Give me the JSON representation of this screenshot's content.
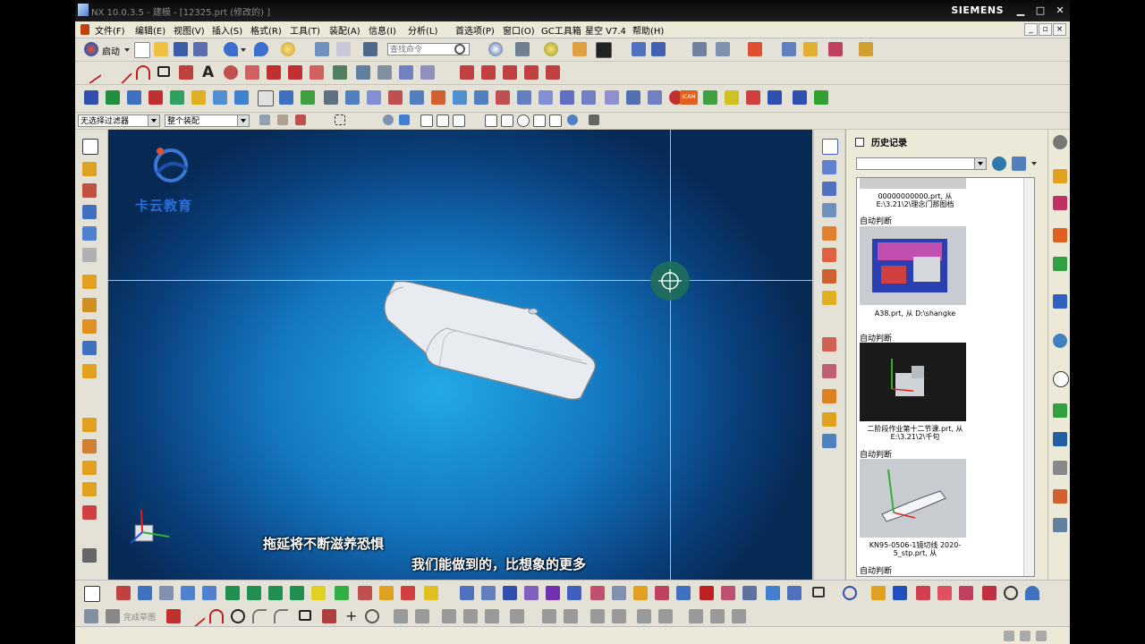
{
  "window": {
    "title": "NX 10.0.3.5 - 建模 - [12325.prt (修改的) ]",
    "brand": "SIEMENS",
    "controls": [
      "▁",
      "□",
      "✕"
    ]
  },
  "menubar": {
    "items": [
      "文件(F)",
      "编辑(E)",
      "视图(V)",
      "插入(S)",
      "格式(R)",
      "工具(T)",
      "装配(A)",
      "信息(I)",
      "分析(L)",
      "首选项(P)",
      "窗口(O)",
      "GC工具箱",
      "星空 V7.4",
      "帮助(H)"
    ],
    "mdi_controls": [
      "_",
      "▫",
      "×"
    ]
  },
  "toolbar": {
    "start_label": "启动",
    "search_placeholder": "查找命令"
  },
  "selection_bar": {
    "filter_value": "无选择过滤器",
    "scope_value": "整个装配"
  },
  "viewport": {
    "logo_text": "卡云教育",
    "subtitle_line1": "拖延将不断滋养恐惧",
    "subtitle_line2": "我们能做到的，比想象的更多"
  },
  "history_panel": {
    "title": "历史记录",
    "entries": [
      {
        "file": "00000000000.prt, 从 E:\\3.21\\2\\理念门那图档",
        "auto": "自动判断"
      },
      {
        "file": "A38.prt, 从 D:\\shangke",
        "auto": "自动判断"
      },
      {
        "file": "二阶段作业第十二节课.prt, 从 E:\\3.21\\2\\千句",
        "auto": "自动判断"
      },
      {
        "file": "KN95-0506-1镜切线 2020-5_stp.prt, 从",
        "auto": "自动判断"
      }
    ]
  },
  "colors": {
    "viewport_center": "#22a9e6",
    "viewport_edge": "#072a55",
    "crosshair": "#e8b8c8",
    "title_bar": "#111111",
    "ui_face": "#e4e1d6"
  },
  "icons": {
    "bottom_toolbar_label": "完成草图"
  }
}
